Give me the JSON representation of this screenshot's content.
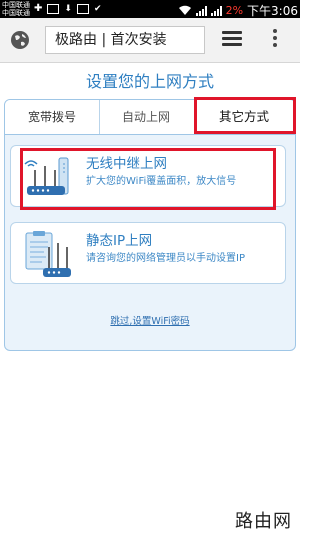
{
  "status_bar": {
    "carrier_1": "中国联通",
    "carrier_2": "中国联通",
    "battery": "2%",
    "time": "下午3:06"
  },
  "toolbar": {
    "url_text": "极路由 | 首次安装"
  },
  "page": {
    "title": "设置您的上网方式"
  },
  "tabs": [
    {
      "label": "宽带拨号"
    },
    {
      "label": "自动上网"
    },
    {
      "label": "其它方式"
    }
  ],
  "options": [
    {
      "title": "无线中继上网",
      "subtitle": "扩大您的WiFi覆盖面积，放大信号",
      "icon": "wireless-router-icon"
    },
    {
      "title": "静态IP上网",
      "subtitle": "请咨询您的网络管理员以手动设置IP",
      "icon": "clipboard-router-icon"
    }
  ],
  "skip_link": "跳过,设置WiFi密码",
  "watermark": "路由网",
  "colors": {
    "accent": "#2f7fc1",
    "highlight": "#e0152a",
    "panel_bg": "#eaf3fb"
  }
}
